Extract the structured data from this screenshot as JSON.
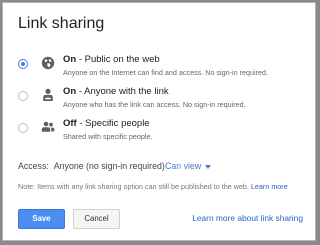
{
  "dialog": {
    "title": "Link sharing"
  },
  "options": [
    {
      "state": "On",
      "label": " - Public on the web",
      "description": "Anyone on the Internet can find and access. No sign-in required.",
      "selected": true,
      "icon": "globe-icon"
    },
    {
      "state": "On",
      "label": " - Anyone with the link",
      "description": "Anyone who has the link can access. No sign-in required.",
      "selected": false,
      "icon": "link-person-icon"
    },
    {
      "state": "Off",
      "label": " - Specific people",
      "description": "Shared with specific people.",
      "selected": false,
      "icon": "people-icon"
    }
  ],
  "access": {
    "label": "Access:",
    "value": "Anyone (no sign-in required)",
    "permission": "Can view"
  },
  "note": {
    "text": "Note: Items with any link sharing option can still be published to the web.",
    "link": "Learn more"
  },
  "footer": {
    "save_label": "Save",
    "cancel_label": "Cancel",
    "learn_more_label": "Learn more about link sharing"
  },
  "colors": {
    "accent": "#4a7ed1",
    "save_button": "#4d8df1",
    "link": "#2a64c5"
  }
}
